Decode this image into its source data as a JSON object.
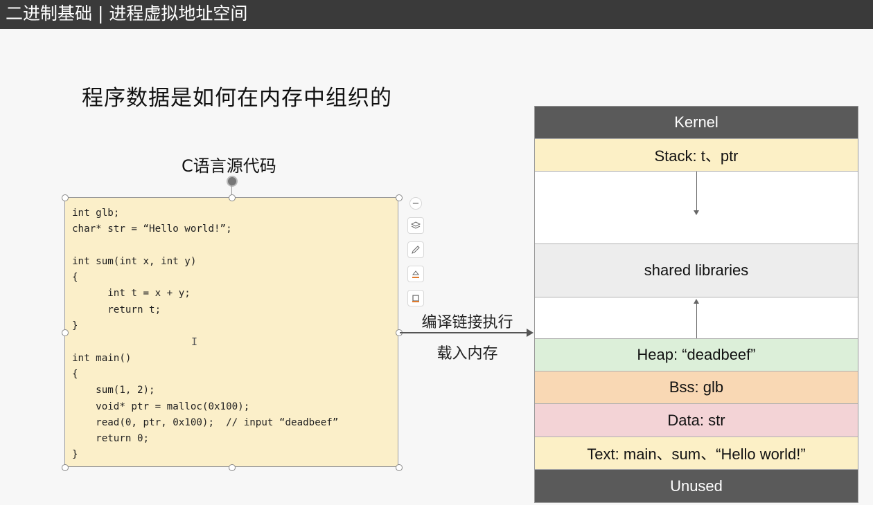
{
  "header": {
    "title": "二进制基础 | 进程虚拟地址空间"
  },
  "slide": {
    "title": "程序数据是如何在内存中组织的",
    "code_caption": "C语言源代码",
    "code_lines": [
      "int glb;",
      "char* str = “Hello world!”;",
      "",
      "int sum(int x, int y)",
      "{",
      "      int t = x + y;",
      "      return t;",
      "}",
      "",
      "int main()",
      "{",
      "    sum(1, 2);",
      "    void* ptr = malloc(0x100);",
      "    read(0, ptr, 0x100);  // input “deadbeef”",
      "    return 0;",
      "}"
    ],
    "arrow_label_top": "编译链接执行",
    "arrow_label_bottom": "载入内存",
    "toolbar": [
      "collapse-icon",
      "layers-icon",
      "pen-icon",
      "fill-icon",
      "crop-icon"
    ]
  },
  "memory_layout": {
    "kernel": "Kernel",
    "stack": "Stack: t、ptr",
    "shared": "shared libraries",
    "heap": "Heap: “deadbeef”",
    "bss": "Bss: glb",
    "data": "Data: str",
    "text": "Text: main、sum、“Hello world!”",
    "unused": "Unused"
  },
  "colors": {
    "kernel": "#5a5a5a",
    "stack": "#fcf0c6",
    "shared": "#ededed",
    "heap": "#dcefd9",
    "bss": "#f9d8b4",
    "data": "#f3d3d6",
    "text": "#fcf0c6",
    "code_bg": "#fbefc9"
  }
}
